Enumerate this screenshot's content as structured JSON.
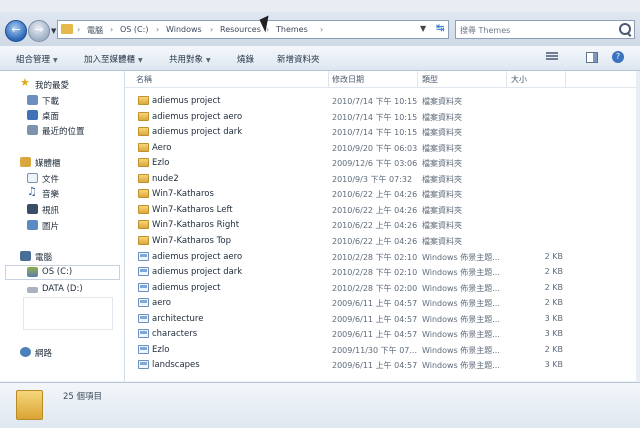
{
  "address": {
    "crumbs": [
      "電腦",
      "OS (C:)",
      "Windows",
      "Resources",
      "Themes"
    ]
  },
  "search": {
    "placeholder": "搜尋 Themes"
  },
  "toolbar": {
    "organize": "組合管理",
    "include_library": "加入至媒體櫃",
    "share": "共用對象",
    "burn": "燒錄",
    "new_folder": "新增資料夾"
  },
  "nav": {
    "favorites": "我的最愛",
    "downloads": "下載",
    "desktop": "桌面",
    "recent": "最近的位置",
    "libraries": "媒體櫃",
    "documents": "文件",
    "music": "音樂",
    "videos": "視訊",
    "pictures": "圖片",
    "computer": "電腦",
    "drive_c": "OS (C:)",
    "drive_d": "DATA (D:)",
    "network": "網路"
  },
  "columns": {
    "name": "名稱",
    "date": "修改日期",
    "type": "類型",
    "size": "大小"
  },
  "files": [
    {
      "name": "adiemus project",
      "date": "2010/7/14 下午 10:15",
      "type": "檔案資料夾",
      "size": "",
      "kind": "folder"
    },
    {
      "name": "adiemus project aero",
      "date": "2010/7/14 下午 10:15",
      "type": "檔案資料夾",
      "size": "",
      "kind": "folder"
    },
    {
      "name": "adiemus project dark",
      "date": "2010/7/14 下午 10:15",
      "type": "檔案資料夾",
      "size": "",
      "kind": "folder"
    },
    {
      "name": "Aero",
      "date": "2010/9/20 下午 06:03",
      "type": "檔案資料夾",
      "size": "",
      "kind": "folder"
    },
    {
      "name": "Ezlo",
      "date": "2009/12/6 下午 03:06",
      "type": "檔案資料夾",
      "size": "",
      "kind": "folder"
    },
    {
      "name": "nude2",
      "date": "2010/9/3 下午 07:32",
      "type": "檔案資料夾",
      "size": "",
      "kind": "folder"
    },
    {
      "name": "Win7-Katharos",
      "date": "2010/6/22 上午 04:26",
      "type": "檔案資料夾",
      "size": "",
      "kind": "folder"
    },
    {
      "name": "Win7-Katharos Left",
      "date": "2010/6/22 上午 04:26",
      "type": "檔案資料夾",
      "size": "",
      "kind": "folder"
    },
    {
      "name": "Win7-Katharos Right",
      "date": "2010/6/22 上午 04:26",
      "type": "檔案資料夾",
      "size": "",
      "kind": "folder"
    },
    {
      "name": "Win7-Katharos Top",
      "date": "2010/6/22 上午 04:26",
      "type": "檔案資料夾",
      "size": "",
      "kind": "folder"
    },
    {
      "name": "adiemus project aero",
      "date": "2010/2/28 下午 02:10",
      "type": "Windows 佈景主題...",
      "size": "2 KB",
      "kind": "theme"
    },
    {
      "name": "adiemus project dark",
      "date": "2010/2/28 下午 02:10",
      "type": "Windows 佈景主題...",
      "size": "2 KB",
      "kind": "theme"
    },
    {
      "name": "adiemus project",
      "date": "2010/2/28 下午 02:00",
      "type": "Windows 佈景主題...",
      "size": "2 KB",
      "kind": "theme"
    },
    {
      "name": "aero",
      "date": "2009/6/11 上午 04:57",
      "type": "Windows 佈景主題...",
      "size": "2 KB",
      "kind": "theme"
    },
    {
      "name": "architecture",
      "date": "2009/6/11 上午 04:57",
      "type": "Windows 佈景主題...",
      "size": "3 KB",
      "kind": "theme"
    },
    {
      "name": "characters",
      "date": "2009/6/11 上午 04:57",
      "type": "Windows 佈景主題...",
      "size": "3 KB",
      "kind": "theme"
    },
    {
      "name": "Ezlo",
      "date": "2009/11/30 下午 07...",
      "type": "Windows 佈景主題...",
      "size": "2 KB",
      "kind": "theme"
    },
    {
      "name": "landscapes",
      "date": "2009/6/11 上午 04:57",
      "type": "Windows 佈景主題...",
      "size": "3 KB",
      "kind": "theme"
    }
  ],
  "details": {
    "count": "25 個項目"
  }
}
